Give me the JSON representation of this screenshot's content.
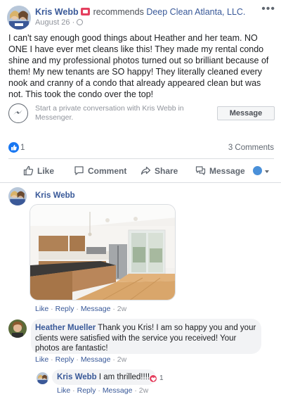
{
  "post": {
    "author": "Kris Webb",
    "verb": "recommends",
    "page": "Deep Clean Atlanta, LLC.",
    "date": "August 26",
    "date_sep": "·",
    "more_label": "•••",
    "text": "I can't say enough good things about Heather and her team. NO ONE I have ever met cleans like this! They made my rental condo shine and my professional photos turned out so brilliant because of them! My new tenants are SO happy! They literally cleaned every nook and cranny of a condo that already appeared clean but was not. This took the condo over the top!"
  },
  "messenger": {
    "prompt": "Start a private conversation with Kris Webb in Messenger.",
    "button": "Message"
  },
  "summary": {
    "likes": "1",
    "comments": "3 Comments"
  },
  "actions": {
    "like": "Like",
    "comment": "Comment",
    "share": "Share",
    "message": "Message"
  },
  "comments": [
    {
      "author": "Kris Webb",
      "actions": [
        "Like",
        "Reply",
        "Message"
      ],
      "time": "2w"
    },
    {
      "author": "Heather Mueller",
      "text": "Thank you Kris! I am so happy you and your clients were satisfied with the service you received! Your photos are fantastic!",
      "actions": [
        "Like",
        "Reply",
        "Message"
      ],
      "time": "2w"
    },
    {
      "author": "Kris Webb",
      "text": "I am thrilled!!!!",
      "reaction_count": "1",
      "actions": [
        "Like",
        "Reply",
        "Message"
      ],
      "time": "2w"
    }
  ],
  "separators": {
    "dot": " · "
  },
  "icons": {
    "globe": "globe-icon",
    "messenger": "messenger-icon",
    "like": "thumbs-up-icon",
    "comment": "comment-icon",
    "share": "share-icon",
    "message": "chat-icon",
    "love": "heart-icon"
  },
  "colors": {
    "link": "#385898",
    "accent": "#1877f2",
    "love": "#e4405f",
    "muted": "#90949c"
  }
}
